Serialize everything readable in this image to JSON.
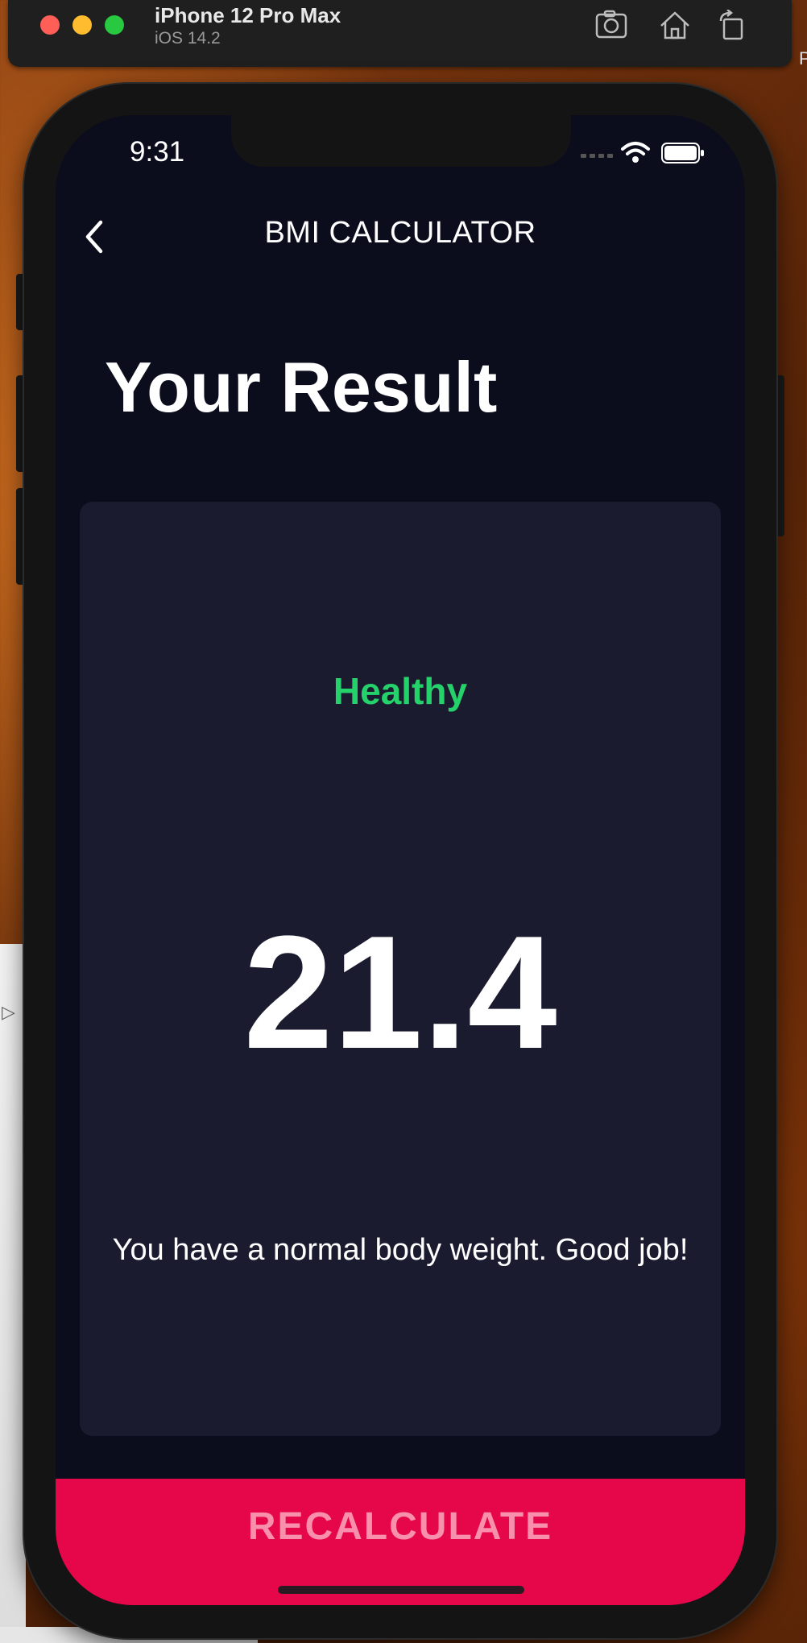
{
  "simulator": {
    "device_name": "iPhone 12 Pro Max",
    "os_version": "iOS 14.2",
    "buttons": [
      {
        "name": "screenshot",
        "icon": "camera-icon"
      },
      {
        "name": "home",
        "icon": "home-icon"
      },
      {
        "name": "rotate",
        "icon": "rotate-icon"
      }
    ],
    "edge_text": "P"
  },
  "status_bar": {
    "time": "9:31",
    "icons": [
      "signal-icon",
      "wifi-icon",
      "battery-icon"
    ]
  },
  "nav": {
    "back_icon": "chevron-left-icon",
    "title": "BMI CALCULATOR"
  },
  "page": {
    "title": "Your Result"
  },
  "result": {
    "status": "Healthy",
    "value": "21.4",
    "message": "You have a normal body weight. Good job!"
  },
  "action": {
    "label": "RECALCULATE"
  },
  "colors": {
    "background": "#0b0d1c",
    "card": "#1a1b2e",
    "status_healthy": "#24d16a",
    "accent": "#e6064a",
    "accent_text": "#f78fad"
  }
}
